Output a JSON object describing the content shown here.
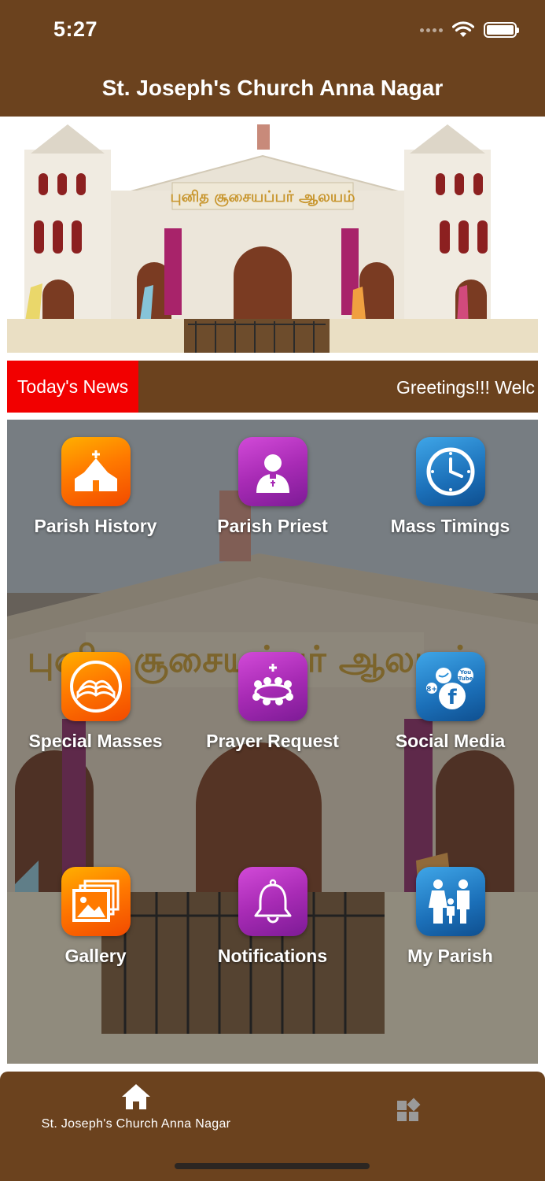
{
  "status_bar": {
    "time": "5:27"
  },
  "header": {
    "title": "St. Joseph's Church Anna Nagar"
  },
  "banner": {
    "facade_text": "புனித சூசையப்பர் ஆலயம்"
  },
  "news": {
    "label": "Today's News",
    "ticker_text": "Greetings!!! Welc"
  },
  "menu": {
    "items": [
      {
        "label": "Parish History",
        "icon": "church-icon"
      },
      {
        "label": "Parish Priest",
        "icon": "priest-icon"
      },
      {
        "label": "Mass Timings",
        "icon": "clock-icon"
      },
      {
        "label": "Special Masses",
        "icon": "bible-icon"
      },
      {
        "label": "Prayer Request",
        "icon": "prayer-group-icon"
      },
      {
        "label": "Social Media",
        "icon": "social-media-icon"
      },
      {
        "label": "Gallery",
        "icon": "gallery-icon"
      },
      {
        "label": "Notifications",
        "icon": "bell-icon"
      },
      {
        "label": "My Parish",
        "icon": "family-icon"
      }
    ]
  },
  "tab_bar": {
    "home_label": "St. Joseph's Church Anna Nagar"
  },
  "colors": {
    "brand_brown": "#6b421e",
    "news_red": "#f20000"
  }
}
